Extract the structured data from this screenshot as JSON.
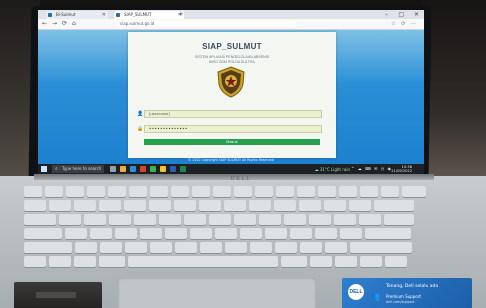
{
  "browser": {
    "tab1_title": "Bi-Sulmut",
    "tab2_title": "SIAP_SULMUT",
    "new_tab_symbol": "+",
    "url": "siap.sulmut.go.id",
    "window_controls": [
      "–",
      "□",
      "✕"
    ],
    "toolbar_icons": "☆ ⟳ ⋯"
  },
  "login": {
    "title": "SIAP_SULMUT",
    "subtitle_line1": "SISTEM APLIKASI PENGELOLAAN ABSENSI",
    "subtitle_line2": "BIRO SDM POLDA SULTRA",
    "logo_icon": "police-emblem-shield",
    "username_value": "[username]",
    "password_value": "••••••••••••••",
    "button_label": "Masuk"
  },
  "screen_footer": "© 2022 Copyright SIAP SULMUT All Rights Reserved",
  "taskbar": {
    "search_placeholder": "Type here to search",
    "weather_text": "☁ 31°C Light rain",
    "tray_icons": "^ ☁ ⌨ ✉ ◷ ◉",
    "time": "10:36",
    "date": "21/09/2022"
  },
  "laptop": {
    "lid_brand": "DELL",
    "sticker_badge": "DELL",
    "sticker_line1": "Tenang, Dell selalu ada",
    "sticker_line2": "Premium Support",
    "sticker_line3": "dell.com/support"
  },
  "colors": {
    "button_green": "#27a04e",
    "desktop_blue": "#2b8fd6",
    "dell_blue": "#1c5fa8"
  }
}
